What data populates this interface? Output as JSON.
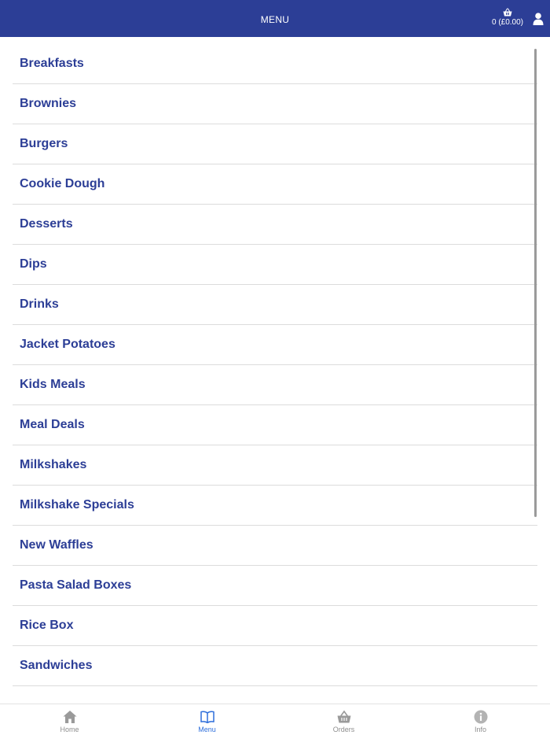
{
  "header": {
    "title": "MENU",
    "basket_count": "0",
    "basket_total": "(£0.00)",
    "basket_icon": "basket-icon",
    "user_icon": "user-icon"
  },
  "menu_items": [
    {
      "label": "Breakfasts"
    },
    {
      "label": "Brownies"
    },
    {
      "label": "Burgers"
    },
    {
      "label": "Cookie Dough"
    },
    {
      "label": "Desserts"
    },
    {
      "label": "Dips"
    },
    {
      "label": "Drinks"
    },
    {
      "label": "Jacket Potatoes"
    },
    {
      "label": "Kids Meals"
    },
    {
      "label": "Meal Deals"
    },
    {
      "label": "Milkshakes"
    },
    {
      "label": "Milkshake Specials"
    },
    {
      "label": "New Waffles"
    },
    {
      "label": "Pasta Salad Boxes"
    },
    {
      "label": "Rice Box"
    },
    {
      "label": "Sandwiches"
    }
  ],
  "tabs": [
    {
      "label": "Home",
      "icon": "home-icon",
      "active": false
    },
    {
      "label": "Menu",
      "icon": "book-icon",
      "active": true
    },
    {
      "label": "Orders",
      "icon": "basket-icon",
      "active": false
    },
    {
      "label": "Info",
      "icon": "info-icon",
      "active": false
    }
  ],
  "colors": {
    "header_bg": "#2c3e96",
    "item_text": "#2c3e96",
    "tab_active": "#2f6fdb",
    "tab_inactive": "#8e8e8e"
  }
}
